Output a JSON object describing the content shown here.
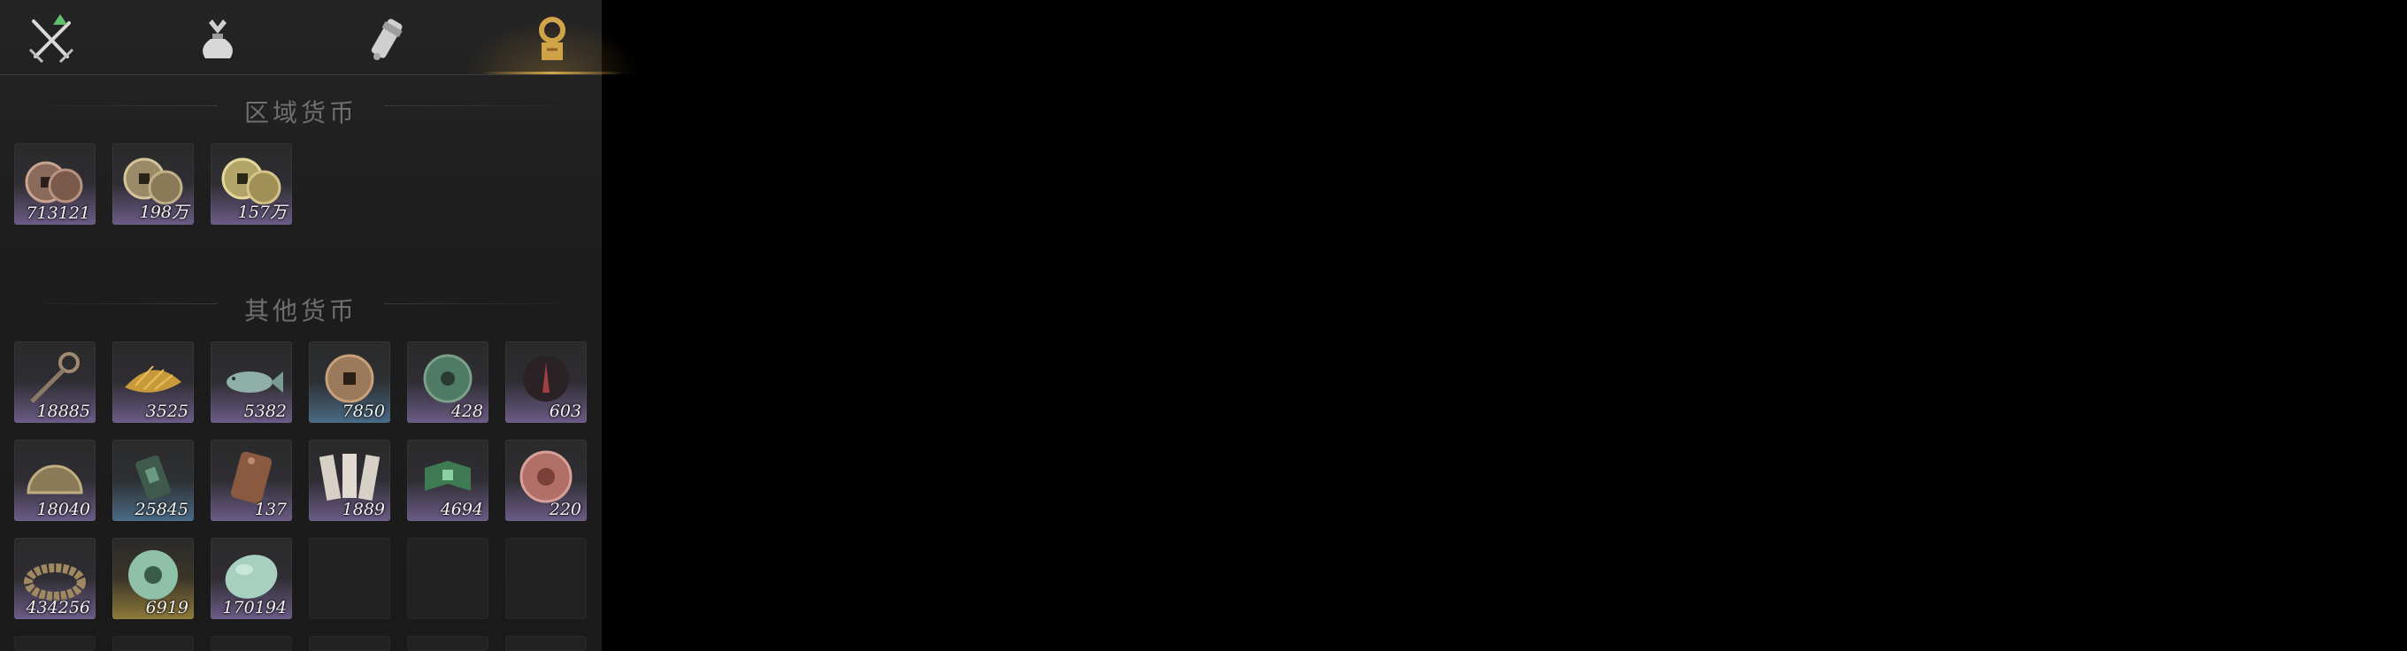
{
  "tabs": [
    {
      "name": "weapons-tab",
      "icon": "crossed-swords-icon",
      "has_badge": true
    },
    {
      "name": "bag-tab",
      "icon": "cloth-bag-icon",
      "has_badge": false
    },
    {
      "name": "scroll-tab",
      "icon": "scroll-icon",
      "has_badge": false
    },
    {
      "name": "currency-tab",
      "icon": "currency-icon",
      "active": true
    }
  ],
  "sections": {
    "regional": {
      "title": "区域货币"
    },
    "other": {
      "title": "其他货币"
    }
  },
  "regional_items": [
    {
      "icon": "copper-coins-icon",
      "count": "713121",
      "rarity": "purple"
    },
    {
      "icon": "bronze-coins-icon",
      "count": "198万",
      "rarity": "purple"
    },
    {
      "icon": "gold-coins-icon",
      "count": "157万",
      "rarity": "purple"
    }
  ],
  "other_items": [
    {
      "icon": "key-coin-icon",
      "count": "18885",
      "rarity": "purple"
    },
    {
      "icon": "gold-shell-icon",
      "count": "3525",
      "rarity": "purple"
    },
    {
      "icon": "jade-fish-icon",
      "count": "5382",
      "rarity": "purple"
    },
    {
      "icon": "square-hole-coin-icon",
      "count": "7850",
      "rarity": "blue"
    },
    {
      "icon": "jade-coin-icon",
      "count": "428",
      "rarity": "purple"
    },
    {
      "icon": "dark-seal-icon",
      "count": "603",
      "rarity": "purple"
    },
    {
      "icon": "half-coin-icon",
      "count": "18040",
      "rarity": "purple"
    },
    {
      "icon": "jade-tablet-icon",
      "count": "25845",
      "rarity": "blue"
    },
    {
      "icon": "bronze-plaque-icon",
      "count": "137",
      "rarity": "purple"
    },
    {
      "icon": "paper-notes-icon",
      "count": "1889",
      "rarity": "purple"
    },
    {
      "icon": "green-banknote-icon",
      "count": "4694",
      "rarity": "purple"
    },
    {
      "icon": "rose-coin-icon",
      "count": "220",
      "rarity": "purple"
    },
    {
      "icon": "coin-string-icon",
      "count": "434256",
      "rarity": "purple"
    },
    {
      "icon": "jade-ring-icon",
      "count": "6919",
      "rarity": "gold"
    },
    {
      "icon": "jade-pebble-icon",
      "count": "170194",
      "rarity": "purple"
    }
  ],
  "colors": {
    "accent": "#d1a54a",
    "rarity_purple": "#6b5b86",
    "rarity_blue": "#4a6a85",
    "rarity_gold": "#8f7a3a",
    "badge_green": "#5fbf6a"
  }
}
